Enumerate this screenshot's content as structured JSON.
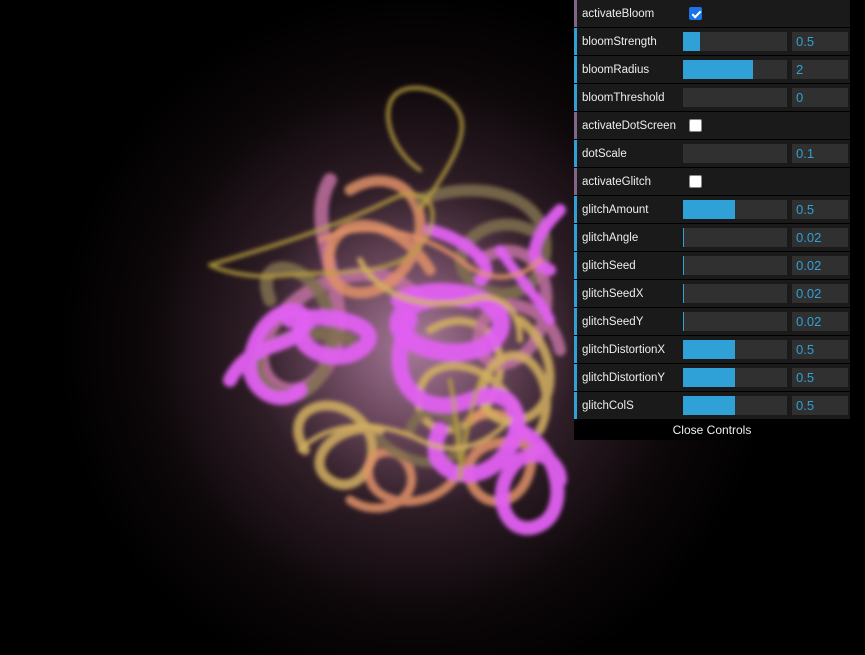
{
  "gui": {
    "close_label": "Close Controls",
    "controls": [
      {
        "label": "activateBloom",
        "type": "bool",
        "checked": true
      },
      {
        "label": "bloomStrength",
        "type": "number",
        "value": "0.5",
        "fraction": 0.16
      },
      {
        "label": "bloomRadius",
        "type": "number",
        "value": "2",
        "fraction": 0.67
      },
      {
        "label": "bloomThreshold",
        "type": "number",
        "value": "0",
        "fraction": 0.0
      },
      {
        "label": "activateDotScreen",
        "type": "bool",
        "checked": false
      },
      {
        "label": "dotScale",
        "type": "number",
        "value": "0.1",
        "fraction": 0.0
      },
      {
        "label": "activateGlitch",
        "type": "bool",
        "checked": false
      },
      {
        "label": "glitchAmount",
        "type": "number",
        "value": "0.5",
        "fraction": 0.5
      },
      {
        "label": "glitchAngle",
        "type": "number",
        "value": "0.02",
        "fraction": 0.01
      },
      {
        "label": "glitchSeed",
        "type": "number",
        "value": "0.02",
        "fraction": 0.01
      },
      {
        "label": "glitchSeedX",
        "type": "number",
        "value": "0.02",
        "fraction": 0.01
      },
      {
        "label": "glitchSeedY",
        "type": "number",
        "value": "0.02",
        "fraction": 0.01
      },
      {
        "label": "glitchDistortionX",
        "type": "number",
        "value": "0.5",
        "fraction": 0.5
      },
      {
        "label": "glitchDistortionY",
        "type": "number",
        "value": "0.5",
        "fraction": 0.5
      },
      {
        "label": "glitchColS",
        "type": "number",
        "value": "0.5",
        "fraction": 0.5
      }
    ]
  },
  "colors": {
    "accent": "#2fa1d6",
    "bool_marker": "#806787",
    "row_bg": "#1a1a1a",
    "field_bg": "#303030",
    "stroke_colors": [
      "#e060f0",
      "#d4b060",
      "#b8a040",
      "#c08070",
      "#e09068",
      "#807050",
      "#c070a0"
    ]
  }
}
